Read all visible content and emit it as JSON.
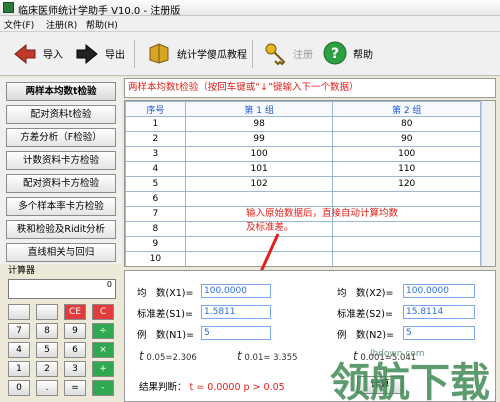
{
  "window": {
    "title": "临床医师统计学助手 V10.0 - 注册版"
  },
  "menu": [
    "文件(F)",
    "注册(R)",
    "帮助(H)"
  ],
  "toolbar": {
    "import_label": "导入",
    "export_label": "导出",
    "tutorial_label": "统计学傻瓜教程",
    "register_label": "注册",
    "help_label": "帮助"
  },
  "left_menu": [
    "两样本均数t检验",
    "配对资料t检验",
    "方差分析（F检验）",
    "计数资料卡方检验",
    "配对资料卡方检验",
    "多个样本率卡方检验",
    "秩和检验及Ridit分析",
    "直线相关与回归"
  ],
  "calculator": {
    "title": "计算器",
    "display": "0",
    "keys": [
      [
        "",
        "",
        "CE",
        "C"
      ],
      [
        "7",
        "8",
        "9",
        "÷"
      ],
      [
        "4",
        "5",
        "6",
        "×"
      ],
      [
        "1",
        "2",
        "3",
        "+"
      ],
      [
        "0",
        ".",
        "=",
        "-"
      ]
    ]
  },
  "hint": "两样本均数t检验（按回车键或“↓”键输入下一个数据）",
  "table": {
    "headers": [
      "序号",
      "第 1 组",
      "第 2 组"
    ],
    "rows": [
      [
        "1",
        "98",
        "80"
      ],
      [
        "2",
        "99",
        "90"
      ],
      [
        "3",
        "100",
        "100"
      ],
      [
        "4",
        "101",
        "110"
      ],
      [
        "5",
        "102",
        "120"
      ],
      [
        "6",
        "",
        ""
      ],
      [
        "7",
        "",
        ""
      ],
      [
        "8",
        "",
        ""
      ],
      [
        "9",
        "",
        ""
      ],
      [
        "10",
        "",
        ""
      ]
    ]
  },
  "annotation": "输入原始数据后，直接自动计算均数及标准差。",
  "results": {
    "mean1_label": "均　数(X1)=",
    "mean1": "100.0000",
    "mean2_label": "均　数(X2)=",
    "mean2": "100.0000",
    "sd1_label": "标准差(S1)=",
    "sd1": "1.5811",
    "sd2_label": "标准差(S2)=",
    "sd2": "15.8114",
    "n1_label": "例　数(N1)=",
    "n1": "5",
    "n2_label": "例　数(N2)=",
    "n2": "5",
    "t05": "0.05=2.306",
    "t01": "0.01= 3.355",
    "t001": "0.001=5.041",
    "verdict_prefix": "结果判断：",
    "verdict_value": "t = 0.0000   p > 0.05",
    "calc_button": "计算"
  },
  "watermark": {
    "text": "领航下载",
    "url": "lhdown.com"
  }
}
